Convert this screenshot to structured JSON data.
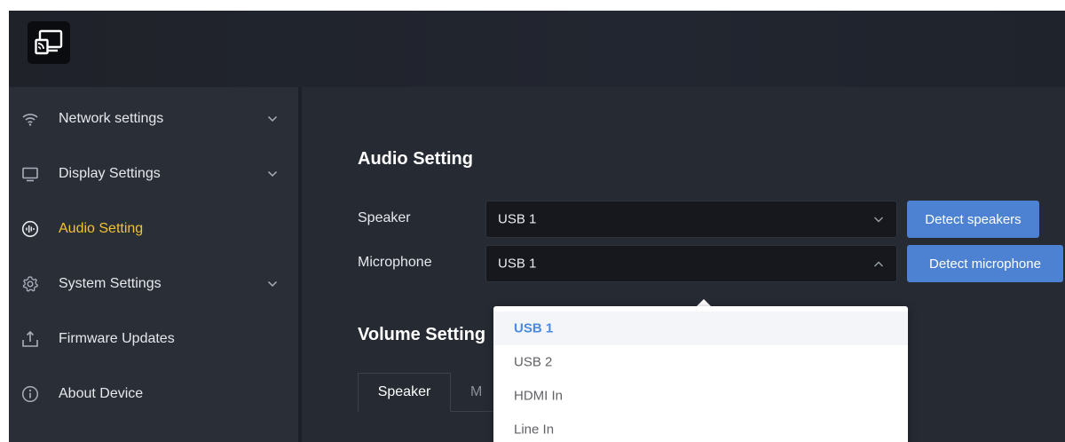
{
  "sidebar": {
    "items": [
      {
        "label": "Network settings",
        "icon": "wifi-icon",
        "expandable": true
      },
      {
        "label": "Display Settings",
        "icon": "monitor-icon",
        "expandable": true
      },
      {
        "label": "Audio Setting",
        "icon": "audio-wave-icon",
        "active": true
      },
      {
        "label": "System Settings",
        "icon": "gear-icon",
        "expandable": true
      },
      {
        "label": "Firmware Updates",
        "icon": "upload-icon"
      },
      {
        "label": "About Device",
        "icon": "info-icon"
      }
    ]
  },
  "audio": {
    "title": "Audio Setting",
    "speaker": {
      "label": "Speaker",
      "value": "USB 1",
      "button": "Detect speakers"
    },
    "microphone": {
      "label": "Microphone",
      "value": "USB 1",
      "button": "Detect microphone"
    }
  },
  "volume": {
    "title": "Volume Setting",
    "tabs": [
      {
        "label": "Speaker",
        "active": true
      },
      {
        "label": "M"
      }
    ]
  },
  "dropdown": {
    "options": [
      "USB 1",
      "USB 2",
      "HDMI In",
      "Line In"
    ],
    "selected": "USB 1"
  },
  "colors": {
    "accent_blue": "#4d82d2",
    "active_nav": "#f2c233",
    "selected_option": "#4a8ae0"
  }
}
